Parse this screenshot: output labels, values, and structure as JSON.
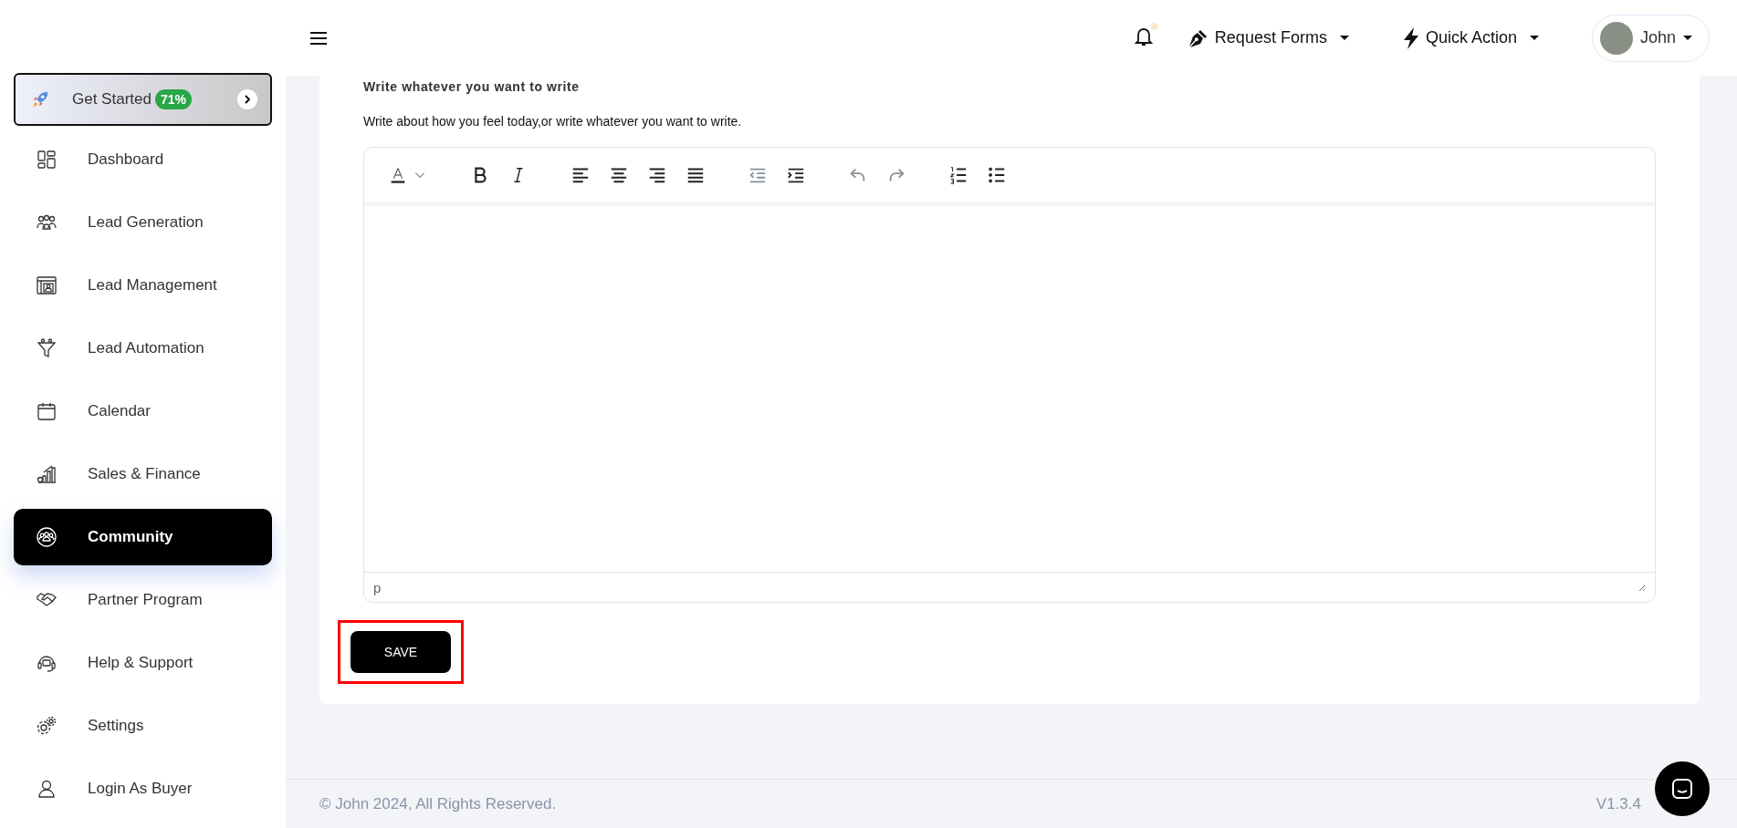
{
  "sidebar": {
    "get_started": {
      "label": "Get Started",
      "badge": "71%"
    },
    "items": [
      {
        "label": "Dashboard",
        "selected": false
      },
      {
        "label": "Lead Generation",
        "selected": false
      },
      {
        "label": "Lead Management",
        "selected": false
      },
      {
        "label": "Lead Automation",
        "selected": false
      },
      {
        "label": "Calendar",
        "selected": false
      },
      {
        "label": "Sales & Finance",
        "selected": false
      },
      {
        "label": "Community",
        "selected": true
      },
      {
        "label": "Partner Program",
        "selected": false
      },
      {
        "label": "Help & Support",
        "selected": false
      },
      {
        "label": "Settings",
        "selected": false
      },
      {
        "label": "Login As Buyer",
        "selected": false
      }
    ]
  },
  "header": {
    "notification_dot": true,
    "menus": [
      {
        "label": "Request Forms"
      },
      {
        "label": "Quick Action"
      }
    ],
    "user": {
      "name": "John"
    }
  },
  "editor": {
    "title": "Write whatever you want to write",
    "description": "Write about how you feel today,or write whatever you want to write.",
    "toolbar": [
      {
        "kind": "color",
        "disabled": false
      },
      {
        "kind": "bold",
        "disabled": false
      },
      {
        "kind": "italic",
        "disabled": false
      },
      {
        "kind": "left",
        "disabled": false
      },
      {
        "kind": "center",
        "disabled": false
      },
      {
        "kind": "right",
        "disabled": false
      },
      {
        "kind": "justify",
        "disabled": false
      },
      {
        "kind": "outdent",
        "disabled": true
      },
      {
        "kind": "indent",
        "disabled": false
      },
      {
        "kind": "undo",
        "disabled": true
      },
      {
        "kind": "redo",
        "disabled": true
      },
      {
        "kind": "numbered",
        "disabled": false
      },
      {
        "kind": "bulleted",
        "disabled": false
      }
    ],
    "status": "p",
    "save": "SAVE",
    "highlighted": true
  },
  "footer": {
    "copyright": "© John 2024, All Rights Reserved.",
    "version": "V1.3.4"
  }
}
